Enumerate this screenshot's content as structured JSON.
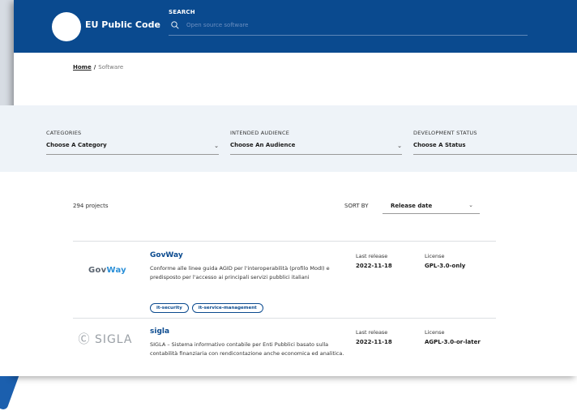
{
  "header": {
    "brand": "EU Public Code",
    "search_label": "SEARCH",
    "search_placeholder": "Open source software"
  },
  "breadcrumb": {
    "home": "Home",
    "separator": "/",
    "current": "Software"
  },
  "filters": {
    "categories": {
      "label": "CATEGORIES",
      "value": "Choose A Category"
    },
    "audience": {
      "label": "INTENDED AUDIENCE",
      "value": "Choose An Audience"
    },
    "status": {
      "label": "DEVELOPMENT STATUS",
      "value": "Choose A Status"
    }
  },
  "results": {
    "count": "294 projects",
    "sort_label": "SORT BY",
    "sort_value": "Release date"
  },
  "projects": [
    {
      "logo_text_a": "Gov",
      "logo_text_b": "Way",
      "title": "GovWay",
      "description": "Conforme alle linee guida AGID per l'interoperabilità (profilo ModI) e predisposto per l'accesso ai principali servizi pubblici italiani",
      "tags": [
        "it-security",
        "it-service-management"
      ],
      "release_label": "Last release",
      "release_date": "2022-11-18",
      "license_label": "License",
      "license": "GPL-3.0-only"
    },
    {
      "logo_text": "SIGLA",
      "title": "sigla",
      "description": "SIGLA – Sistema informativo contabile per Enti Pubblici basato sulla contabilità finanziaria con rendicontazione anche economica ed analitica.",
      "tags": [],
      "release_label": "Last release",
      "release_date": "2022-11-18",
      "license_label": "License",
      "license": "AGPL-3.0-or-later"
    }
  ],
  "colors": {
    "header_bg": "#0a4a8f",
    "filters_bg": "#eef3f8",
    "link": "#0a4a8f"
  }
}
